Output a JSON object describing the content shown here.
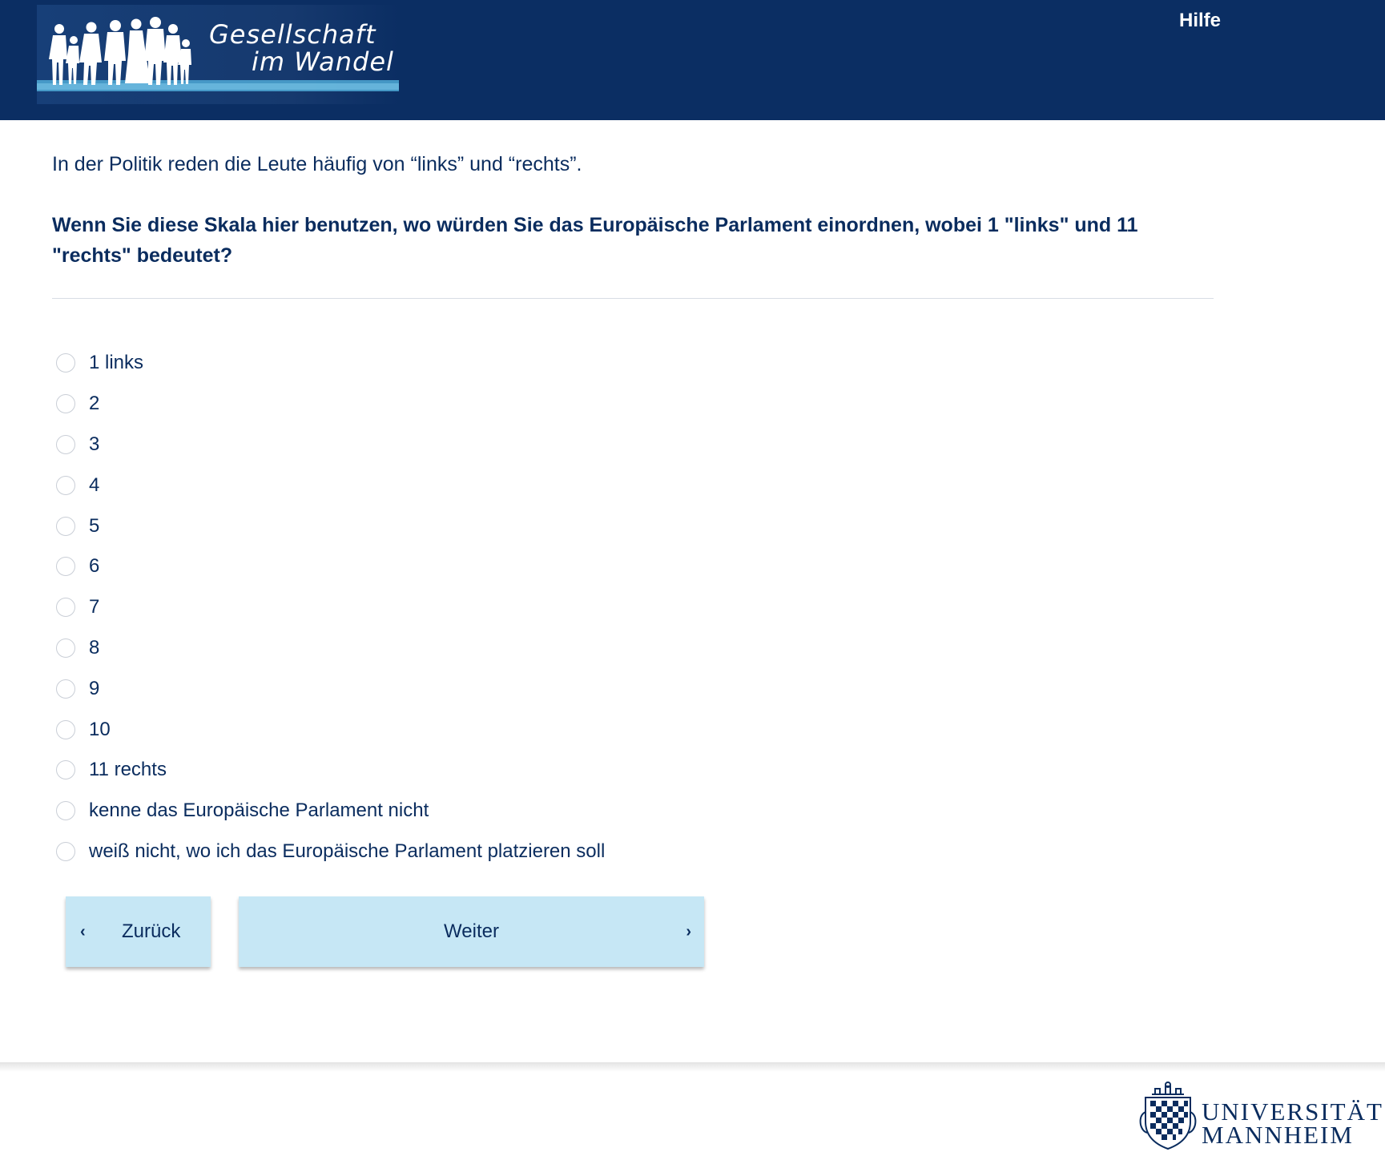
{
  "header": {
    "logo_line1": "Gesellschaft",
    "logo_line2": "im Wandel",
    "help_label": "Hilfe"
  },
  "intro_text": "In der Politik reden die Leute häufig von “links” und “rechts”.",
  "question_text": "Wenn Sie diese Skala hier benutzen, wo würden Sie das Europäische Parlament einordnen, wobei 1 \"links\" und 11 \"rechts\" bedeutet?",
  "options": [
    "1 links",
    "2",
    "3",
    "4",
    "5",
    "6",
    "7",
    "8",
    "9",
    "10",
    "11 rechts",
    "kenne das Europäische Parlament nicht",
    "weiß nicht, wo ich das Europäische Parlament platzieren soll"
  ],
  "selected_option": null,
  "buttons": {
    "back_label": "Zurück",
    "next_label": "Weiter",
    "back_icon": "chevron-left-icon",
    "next_icon": "chevron-right-icon"
  },
  "footer": {
    "uni_line1": "UNIVERSITÄT",
    "uni_line2": "MANNHEIM"
  },
  "colors": {
    "header_bg": "#0b2e63",
    "text": "#0a2c5e",
    "button_bg": "#c6e7f5"
  }
}
